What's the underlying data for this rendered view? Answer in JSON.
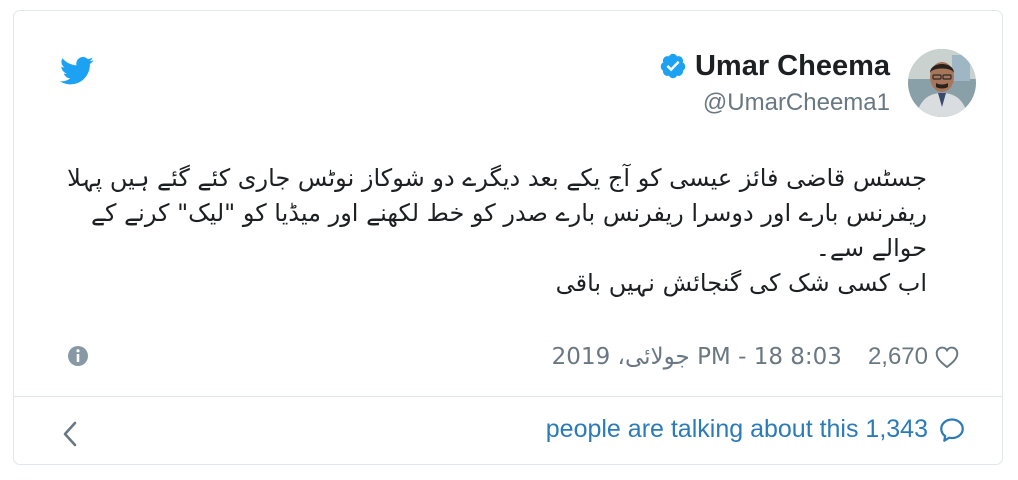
{
  "author": {
    "display_name": "Umar Cheema",
    "handle": "@UmarCheema1"
  },
  "tweet": {
    "paragraph_1": "جسٹس قاضی فائز عیسی کو آج یکے بعد دیگرے دو شوکاز نوٹس جاری کئے گئے ہیں پہلا ریفرنس بارے اور دوسرا ریفرنس بارے صدر کو خط لکھنے اور میڈیا کو \"لیک\" کرنے کے حوالے سے۔",
    "paragraph_2": "اب کسی شک کی گنجائش نہیں باقی"
  },
  "meta": {
    "like_count": "2,670",
    "timestamp": "8:03 PM - 18 جولائی، 2019"
  },
  "footer": {
    "talking_text": "people are talking about this 1,343"
  },
  "icons": {
    "twitter": "twitter-bird-icon",
    "verified": "verified-badge-icon",
    "info": "info-icon",
    "like": "heart-icon",
    "back": "chevron-left-icon",
    "conversation": "speech-bubble-icon"
  },
  "colors": {
    "twitter_blue": "#1da1f2",
    "link_blue": "#2b7bb9",
    "muted_gray": "#697882",
    "text": "#1c2022",
    "border": "#e1e8ed"
  }
}
